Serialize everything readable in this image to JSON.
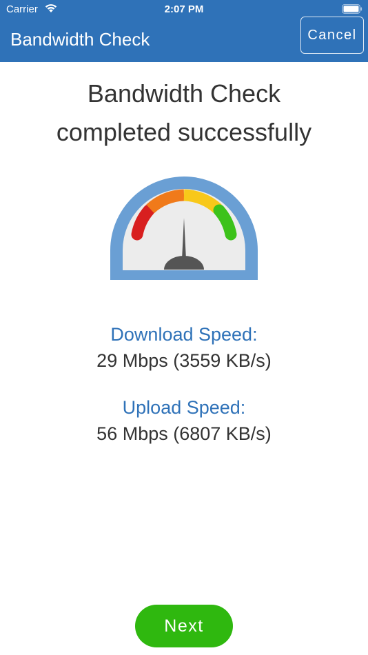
{
  "status_bar": {
    "carrier": "Carrier",
    "time": "2:07 PM"
  },
  "nav": {
    "title": "Bandwidth Check",
    "cancel_label": "Cancel"
  },
  "headline": {
    "line1": "Bandwidth Check",
    "line2": "completed successfully"
  },
  "gauge": {
    "icon": "speedometer-icon",
    "segment_colors": [
      "#d81f1f",
      "#f07a1a",
      "#f8c81a",
      "#3cc21a"
    ],
    "rim_color": "#6a9fd4",
    "needle_color": "#555555"
  },
  "results": {
    "download_label": "Download Speed:",
    "download_value": "29 Mbps (3559 KB/s)",
    "upload_label": "Upload Speed:",
    "upload_value": "56 Mbps (6807 KB/s)"
  },
  "footer": {
    "next_label": "Next"
  },
  "colors": {
    "primary": "#2f72b8",
    "accent_green": "#2fb80f",
    "text": "#333333"
  }
}
